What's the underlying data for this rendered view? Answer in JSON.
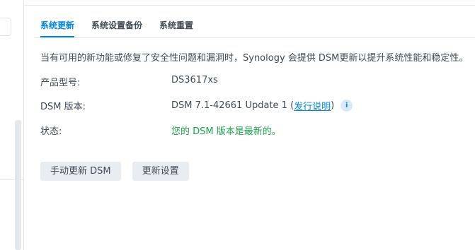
{
  "tabs": [
    {
      "label": "系统更新",
      "active": true
    },
    {
      "label": "系统设置备份",
      "active": false
    },
    {
      "label": "系统重置",
      "active": false
    }
  ],
  "intro_text": "当有可用的新功能或修复了安全性问题和漏洞时，Synology 会提供 DSM更新以提升系统性能和稳定性。",
  "info": {
    "model_label": "产品型号:",
    "model_value": "DS3617xs",
    "version_label": "DSM 版本:",
    "version_value": "DSM 7.1-42661 Update 1 (",
    "release_notes_link": "发行说明",
    "version_suffix": ")",
    "status_label": "状态:",
    "status_value": "您的 DSM 版本是最新的。"
  },
  "buttons": {
    "manual_update": "手动更新 DSM",
    "update_settings": "更新设置"
  },
  "icons": {
    "info": "info-icon"
  },
  "colors": {
    "accent": "#0086e5",
    "status_ok": "#1aa34a",
    "text": "#414b55",
    "button_bg": "#e9edf2"
  }
}
